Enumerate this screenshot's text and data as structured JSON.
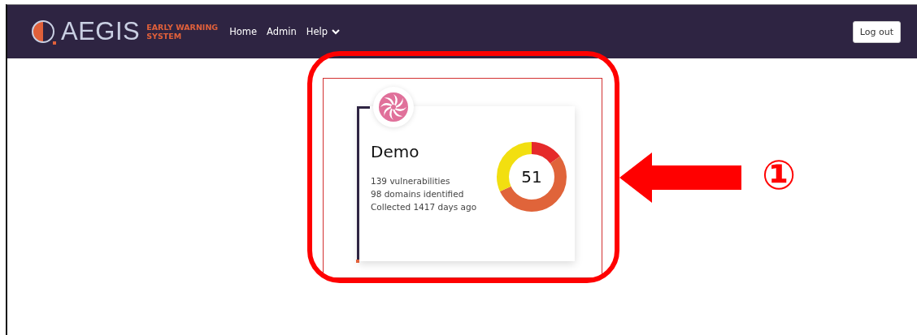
{
  "navbar": {
    "brand": "AEGIS",
    "tagline": [
      "EARLY WARNING",
      "SYSTEM"
    ],
    "links": [
      {
        "label": "Home",
        "kind": "link"
      },
      {
        "label": "Admin",
        "kind": "link"
      },
      {
        "label": "Help",
        "kind": "dropdown"
      }
    ],
    "logout_button": "Log out"
  },
  "card": {
    "title": "Demo",
    "lines": [
      "139 vulnerabilities",
      "98 domains identified",
      "Collected 1417 days ago"
    ],
    "score": "51"
  },
  "annotation": {
    "number": "①"
  }
}
